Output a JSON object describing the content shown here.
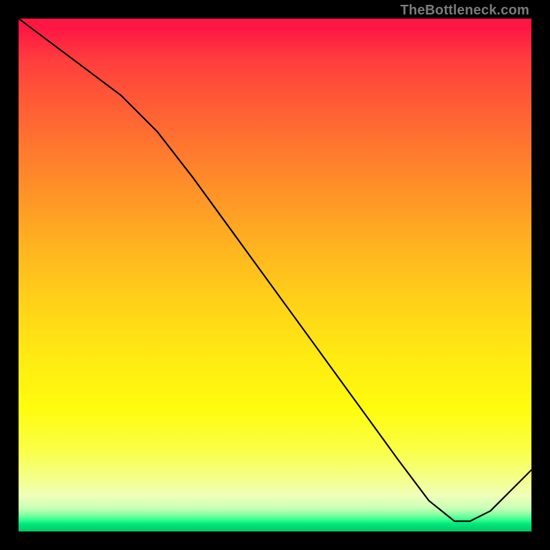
{
  "watermark": "TheBottleneck.com",
  "chart_data": {
    "type": "line",
    "title": "",
    "xlabel": "",
    "ylabel": "",
    "xlim": [
      0,
      100
    ],
    "ylim": [
      0,
      100
    ],
    "background_gradient": {
      "top": "#ff1744",
      "middle": "#ffea12",
      "bottom": "#00cc66"
    },
    "series": [
      {
        "name": "bottleneck-curve",
        "color": "#000000",
        "x": [
          0,
          8,
          20,
          27,
          34,
          42,
          50,
          58,
          66,
          74,
          80,
          85,
          88,
          92,
          100
        ],
        "values": [
          100,
          94,
          85,
          78,
          69,
          58,
          47,
          36,
          25,
          14,
          6,
          2,
          2,
          4,
          12
        ]
      }
    ],
    "annotations": []
  }
}
